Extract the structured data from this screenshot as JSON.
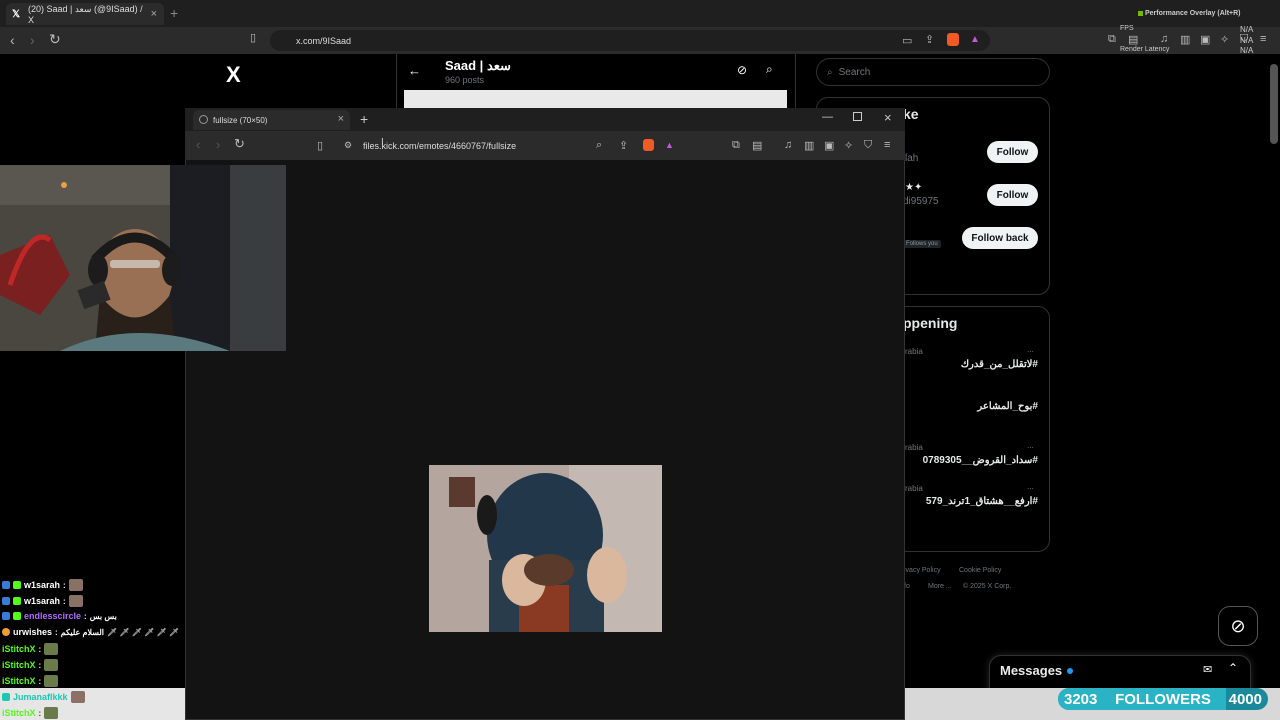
{
  "outer_browser": {
    "tab_title": "(20) Saad | سعد (@9ISaad) / X",
    "new_tab": "+",
    "url": "x.com/9ISaad",
    "perf_overlay": {
      "title": "Performance Overlay (Alt+R)",
      "fps_label": "FPS",
      "fps_value": "N/A",
      "render_latency_label": "Render Latency",
      "render_latency_value": "N/A",
      "extra_value": "N/A"
    }
  },
  "x_page": {
    "logo": "X",
    "profile_name": "Saad | سعد",
    "posts_count": "960 posts",
    "search_placeholder": "Search",
    "who_to_follow_title": "ke",
    "suggestions": [
      {
        "name": "",
        "handle": "lah",
        "button": "Follow"
      },
      {
        "name": "★✦",
        "handle": "di95975",
        "button": "Follow"
      },
      {
        "name": "",
        "handle": "",
        "follows_you": "Follows you",
        "button": "Follow back"
      }
    ],
    "trending_title": "ppening",
    "trends": [
      {
        "context": "rabia",
        "tag": "#لاتقلل_من_قدرك"
      },
      {
        "context": "",
        "tag": "#بوح_المشاعر"
      },
      {
        "context": "rabia",
        "tag": "#سداد_القروض__0789305"
      },
      {
        "context": "rabia",
        "tag": "#ارفع__هشتاق_1ترند_579"
      }
    ],
    "more_dots": "...",
    "footer": {
      "privacy": "ivacy Policy",
      "cookie": "Cookie Policy",
      "fo": "fo",
      "more": "More ...",
      "copyright": "© 2025 X Corp."
    },
    "messages_label": "Messages"
  },
  "popup_browser": {
    "tab_title": "fullsize (70×50)",
    "new_tab": "+",
    "url": "files.kick.com/emotes/4660767/fullsize"
  },
  "chat": [
    {
      "user": "w1sarah",
      "color": "#ffffff",
      "message": ""
    },
    {
      "user": "w1sarah",
      "color": "#ffffff",
      "message": ""
    },
    {
      "user": "endlesscircle",
      "color": "#b36bff",
      "message": "بس بس"
    },
    {
      "user": "urwishes",
      "color": "#ffffff",
      "message": "السلام عليكم"
    },
    {
      "user": "iStitchX",
      "color": "#53fc18",
      "message": ""
    },
    {
      "user": "iStitchX",
      "color": "#53fc18",
      "message": ""
    },
    {
      "user": "iStitchX",
      "color": "#53fc18",
      "message": ""
    },
    {
      "user": "Jumanaflkkk",
      "color": "#19c9b2",
      "message": ""
    },
    {
      "user": "iStitchX",
      "color": "#53fc18",
      "message": ""
    }
  ],
  "follower_goal": {
    "current": "3203",
    "label": "FOLLOWERS",
    "target": "4000",
    "progress": 0.8
  },
  "colors": {
    "x_bg": "#000000",
    "popup_bg": "#131313",
    "goal_fill": "#2ab3c4",
    "kick_green": "#53fc18"
  }
}
